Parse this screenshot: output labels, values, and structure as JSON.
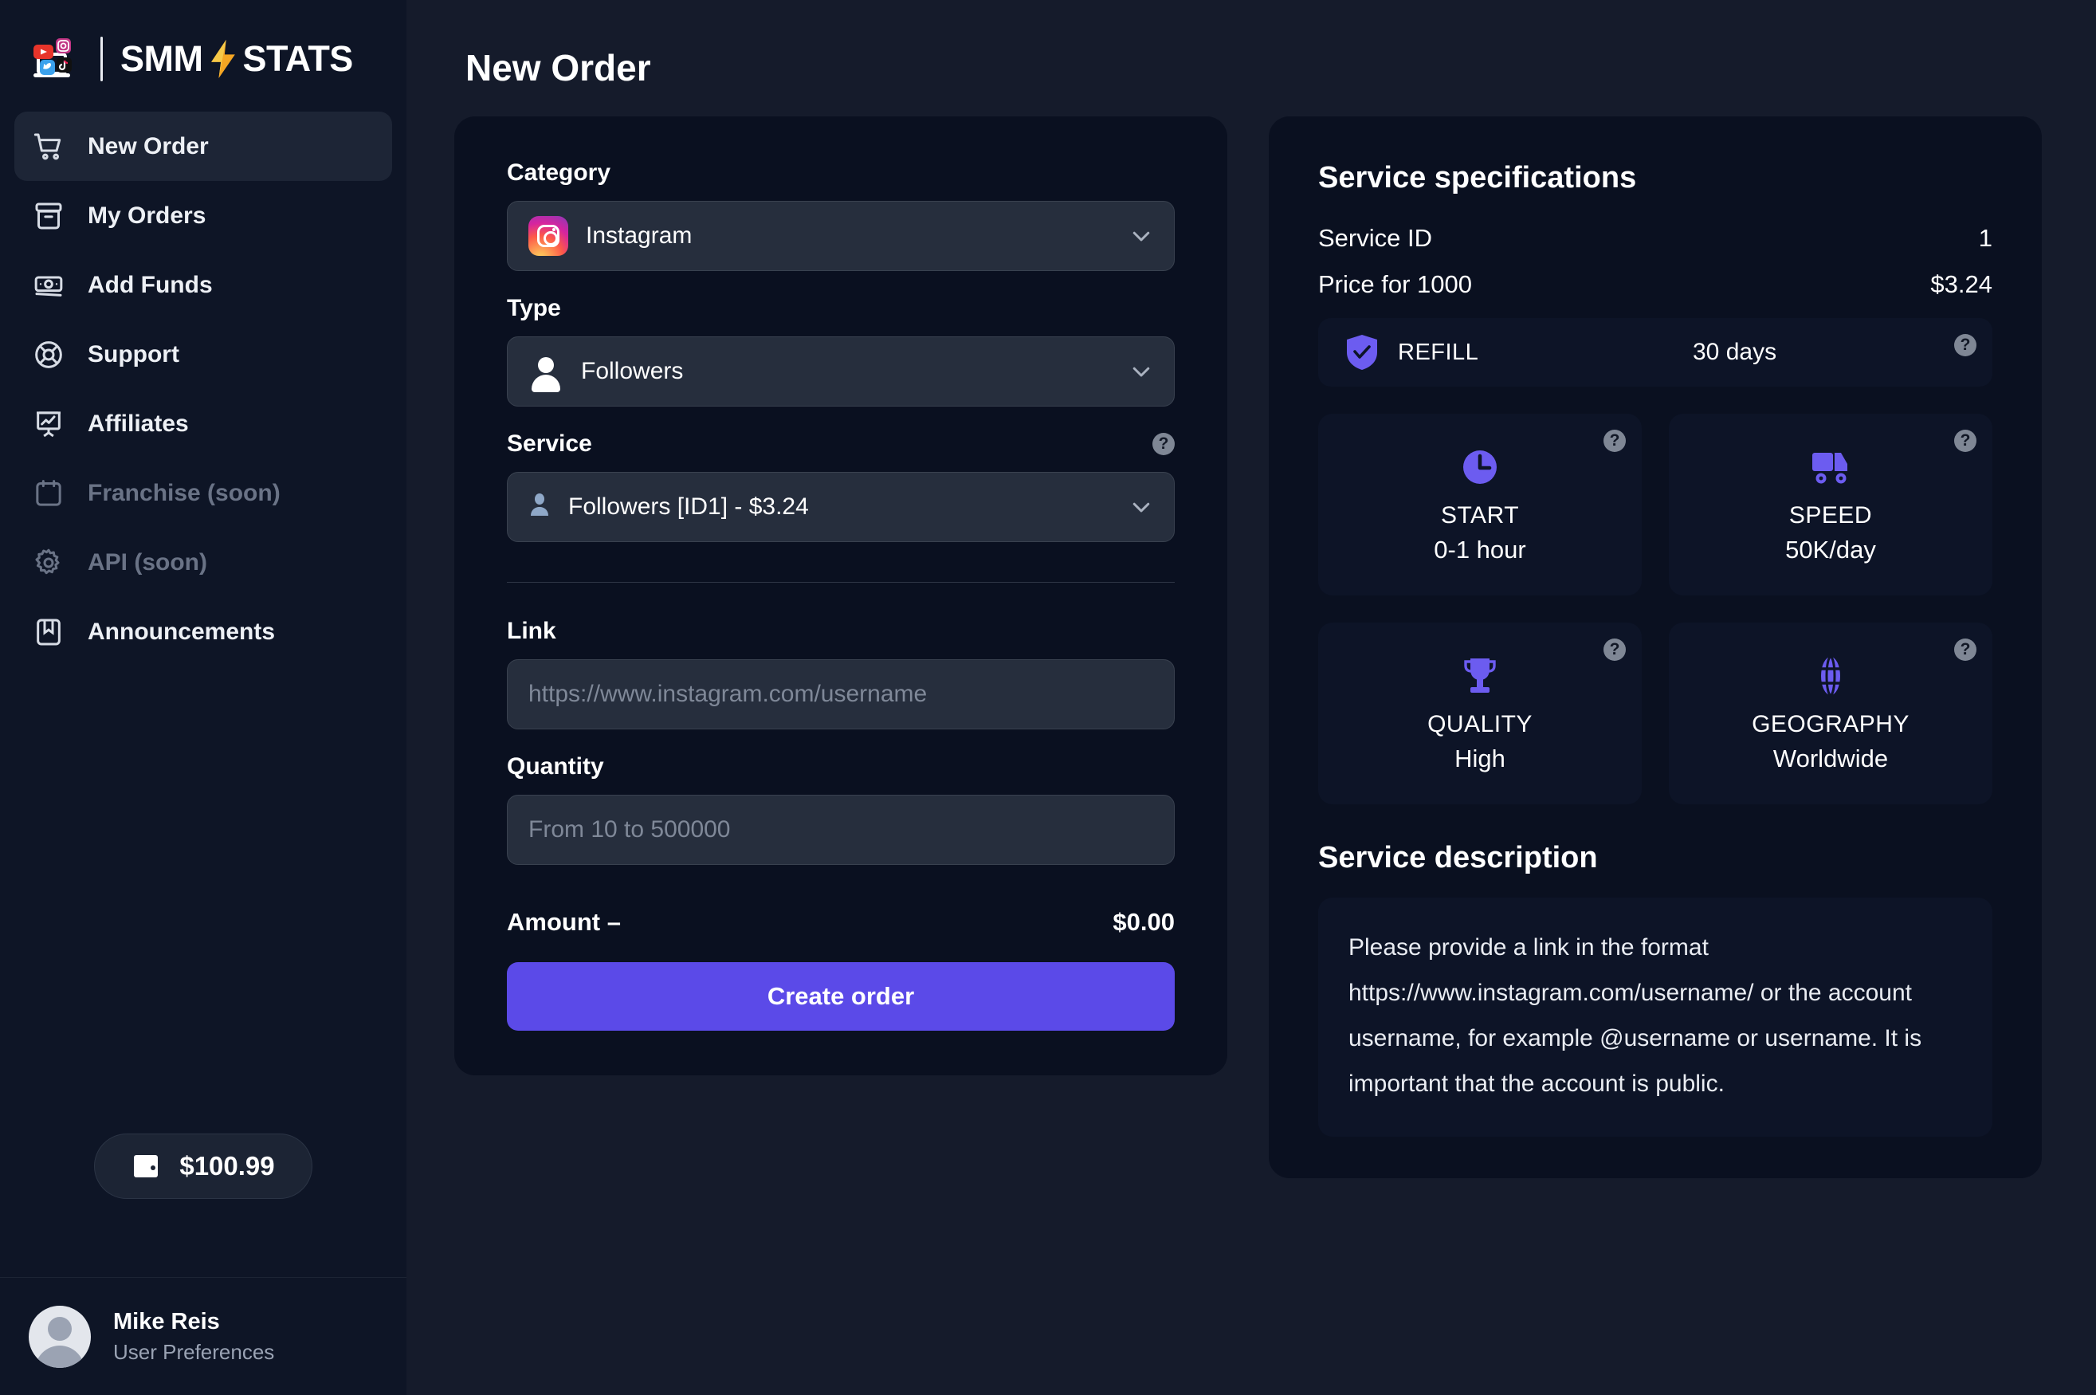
{
  "brand": {
    "name_part1": "SMM",
    "name_part2": "STATS",
    "logo_icons": [
      "youtube-icon",
      "instagram-icon",
      "twitter-icon",
      "tiktok-icon"
    ],
    "accent": "#5B4AE8"
  },
  "sidebar": {
    "items": [
      {
        "label": "New Order",
        "icon": "shopping-cart-icon",
        "active": true,
        "disabled": false
      },
      {
        "label": "My Orders",
        "icon": "archive-box-icon",
        "active": false,
        "disabled": false
      },
      {
        "label": "Add Funds",
        "icon": "banknote-icon",
        "active": false,
        "disabled": false
      },
      {
        "label": "Support",
        "icon": "lifebuoy-icon",
        "active": false,
        "disabled": false
      },
      {
        "label": "Affiliates",
        "icon": "chart-board-icon",
        "active": false,
        "disabled": false
      },
      {
        "label": "Franchise (soon)",
        "icon": "calendar-icon",
        "active": false,
        "disabled": true
      },
      {
        "label": "API (soon)",
        "icon": "gear-icon",
        "active": false,
        "disabled": true
      },
      {
        "label": "Announcements",
        "icon": "bookmark-book-icon",
        "active": false,
        "disabled": false
      }
    ],
    "balance": "$100.99",
    "balance_icon": "wallet-icon",
    "user": {
      "name": "Mike Reis",
      "subtitle": "User Preferences",
      "avatar": "default-avatar-icon"
    }
  },
  "header": {
    "title": "New Order"
  },
  "order_form": {
    "category": {
      "label": "Category",
      "value": "Instagram",
      "icon": "instagram-icon",
      "chevron": "chevron-down-icon"
    },
    "type": {
      "label": "Type",
      "value": "Followers",
      "icon": "person-icon",
      "chevron": "chevron-down-icon"
    },
    "service": {
      "label": "Service",
      "value": "Followers [ID1] - $3.24",
      "icon": "bust-in-silhouette-emoji",
      "chevron": "chevron-down-icon",
      "help": "?"
    },
    "link": {
      "label": "Link",
      "value": "",
      "placeholder": "https://www.instagram.com/username"
    },
    "quantity": {
      "label": "Quantity",
      "value": "",
      "placeholder": "From 10 to 500000"
    },
    "amount": {
      "label": "Amount –",
      "value": "$0.00"
    },
    "submit": {
      "label": "Create order"
    }
  },
  "specs": {
    "title": "Service specifications",
    "rows": [
      {
        "key": "Service ID",
        "value": "1"
      },
      {
        "key": "Price for 1000",
        "value": "$3.24"
      }
    ],
    "refill": {
      "name": "REFILL",
      "value": "30 days",
      "icon": "shield-check-icon",
      "help": "?"
    },
    "tiles": [
      {
        "name": "START",
        "value": "0-1 hour",
        "icon": "clock-icon",
        "help": "?"
      },
      {
        "name": "SPEED",
        "value": "50K/day",
        "icon": "truck-icon",
        "help": "?"
      },
      {
        "name": "QUALITY",
        "value": "High",
        "icon": "trophy-icon",
        "help": "?"
      },
      {
        "name": "GEOGRAPHY",
        "value": "Worldwide",
        "icon": "globe-icon",
        "help": "?"
      }
    ],
    "description_title": "Service description",
    "description": "Please provide a link in the format https://www.instagram.com/username/ or the account username, for example @username or username. It is important that the account is public."
  }
}
